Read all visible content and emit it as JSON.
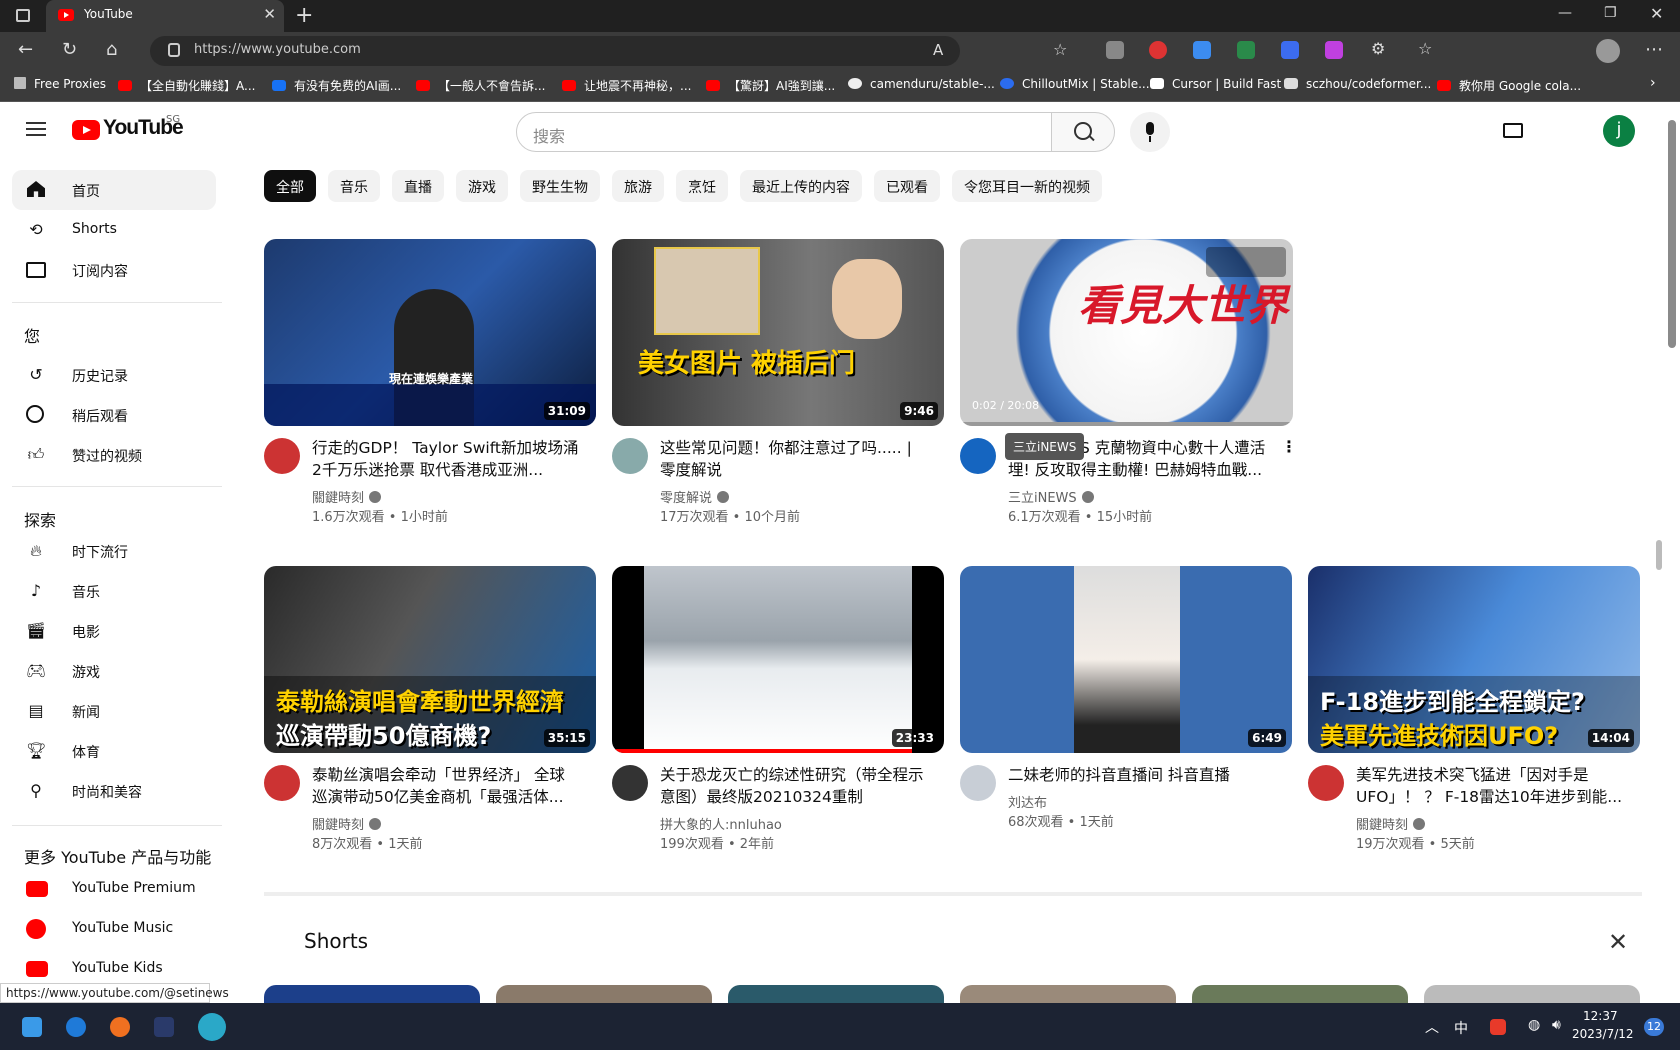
{
  "browser": {
    "tab_title": "YouTube",
    "url": "https://www.youtube.com",
    "bookmarks": [
      "Free Proxies",
      "【全自動化賺錢】A...",
      "有没有免费的AI画...",
      "【一般人不會告訴...",
      "让地震不再神秘，...",
      "【驚訝】AI強到讓...",
      "camenduru/stable-...",
      "ChilloutMix | Stable...",
      "Cursor | Build Fast",
      "sczhou/codeformer...",
      "教你用 Google cola..."
    ]
  },
  "header": {
    "logo_text": "YouTube",
    "region": "SG",
    "search_placeholder": "搜索",
    "avatar_letter": "j"
  },
  "sidebar": {
    "main": [
      {
        "label": "首页",
        "icon": "home-icon"
      },
      {
        "label": "Shorts",
        "icon": "shorts-icon"
      },
      {
        "label": "订阅内容",
        "icon": "subscriptions-icon"
      }
    ],
    "you_heading": "您",
    "you": [
      {
        "label": "历史记录",
        "icon": "history-icon"
      },
      {
        "label": "稍后观看",
        "icon": "watch-later-icon"
      },
      {
        "label": "赞过的视频",
        "icon": "thumbs-up-icon"
      }
    ],
    "explore_heading": "探索",
    "explore": [
      {
        "label": "时下流行",
        "icon": "trending-icon"
      },
      {
        "label": "音乐",
        "icon": "music-icon"
      },
      {
        "label": "电影",
        "icon": "movie-icon"
      },
      {
        "label": "游戏",
        "icon": "gaming-icon"
      },
      {
        "label": "新闻",
        "icon": "news-icon"
      },
      {
        "label": "体育",
        "icon": "trophy-icon"
      },
      {
        "label": "时尚和美容",
        "icon": "fashion-icon"
      }
    ],
    "more_heading": "更多 YouTube 产品与功能",
    "more": [
      {
        "label": "YouTube Premium"
      },
      {
        "label": "YouTube Music"
      },
      {
        "label": "YouTube Kids"
      }
    ]
  },
  "chips": [
    "全部",
    "音乐",
    "直播",
    "游戏",
    "野生生物",
    "旅游",
    "烹饪",
    "最近上传的内容",
    "已观看",
    "令您耳目一新的视频"
  ],
  "videos": [
    {
      "title": "行走的GDP！ Taylor Swift新加坡场涌2千万乐迷抢票 取代香港成亚洲...",
      "channel": "關鍵時刻",
      "meta": "1.6万次观看 • 1小时前",
      "duration": "31:09",
      "overlay": "現在連娛樂產業"
    },
    {
      "title": "这些常见问题！你都注意过了吗..... | 零度解说",
      "channel": "零度解说",
      "meta": "17万次观看 • 10个月前",
      "duration": "9:46",
      "overlay": "美女图片 被插后门"
    },
    {
      "title": "三立iNEWS 克蘭物資中心數十人遭活埋! 反攻取得主動權! 巴赫姆特血戰...",
      "channel": "三立iNEWS",
      "meta": "6.1万次观看 • 15小时前",
      "duration": "0:02 / 20:08",
      "overlay": "看見大世界",
      "tooltip": "三立iNEWS"
    },
    {
      "title": "泰勒丝演唱会牵动「世界经济」 全球巡演带动50亿美金商机「最强活体...",
      "channel": "關鍵時刻",
      "meta": "8万次观看 • 1天前",
      "duration": "35:15",
      "overlay": "泰勒絲演唱會牽動世界經濟",
      "overlay2": "巡演帶動50億商機?"
    },
    {
      "title": "关于恐龙灭亡的综述性研究（带全程示意图）最终版20210324重制",
      "channel": "拼大象的人:nnluhao",
      "meta": "199次观看 • 2年前",
      "duration": "23:33"
    },
    {
      "title": "二妹老师的抖音直播间 抖音直播",
      "channel": "刘达布",
      "meta": "68次观看 • 1天前",
      "duration": "6:49"
    },
    {
      "title": "美军先进技术突飞猛进「因对手是UFO」！ ？ F-18雷达10年进步到能...",
      "channel": "關鍵時刻",
      "meta": "19万次观看 • 5天前",
      "duration": "14:04",
      "overlay": "F-18進步到能全程鎖定?",
      "overlay2": "美軍先進技術因UFO?"
    }
  ],
  "shorts_heading": "Shorts",
  "status_url": "https://www.youtube.com/@setinews",
  "taskbar": {
    "time": "12:37",
    "date": "2023/7/12",
    "ime": "中",
    "badge": "12"
  }
}
